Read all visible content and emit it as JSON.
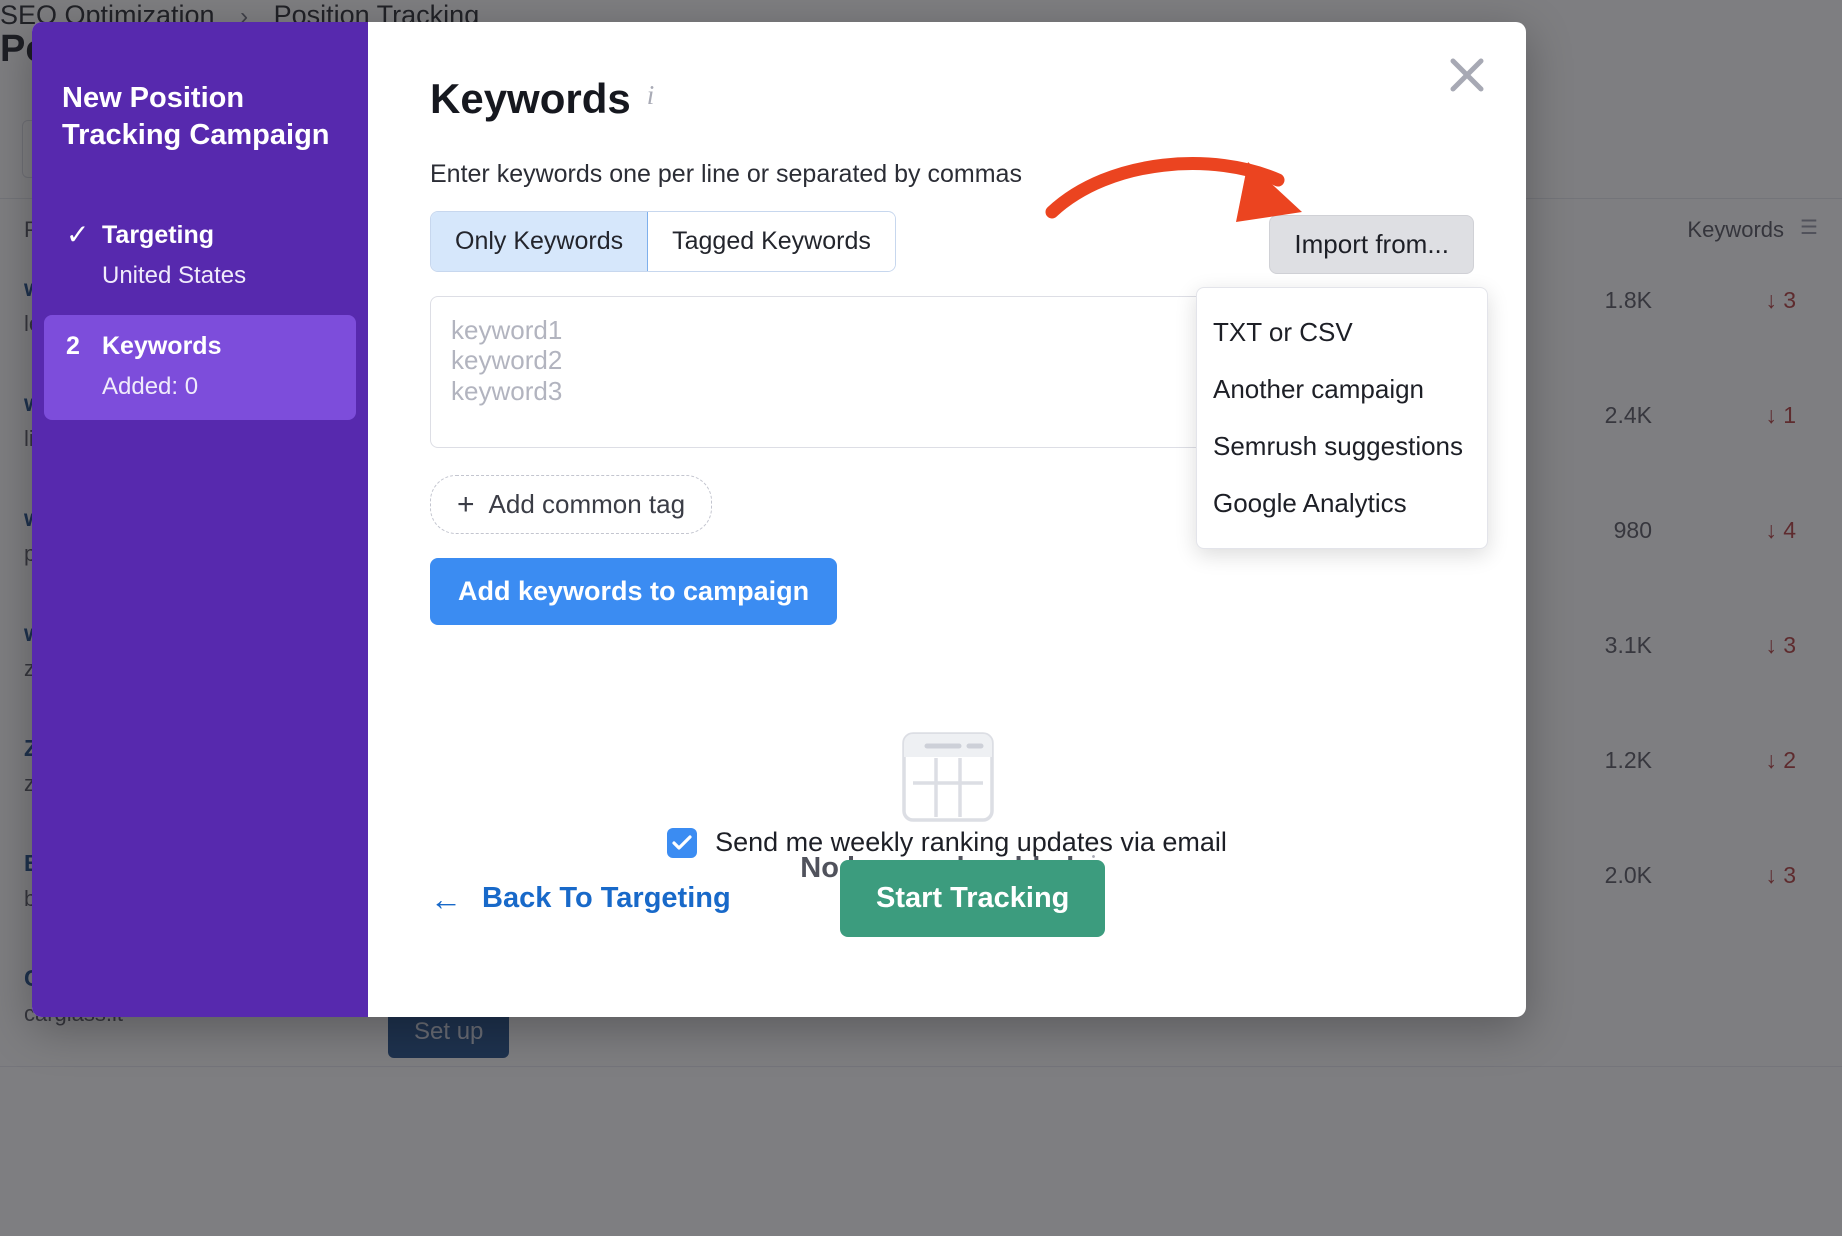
{
  "background": {
    "breadcrumb": {
      "parent": "SEO Optimization",
      "separator": "›",
      "current": "Position Tracking"
    },
    "page_title": "Position Tracking",
    "table": {
      "header_left": "Project",
      "header_right": "Keywords",
      "rows": [
        {
          "name": "www.autoglass.com",
          "url": "leoscheider.com",
          "metric": "1.8K",
          "delta": "↓ 3"
        },
        {
          "name": "www.vetro.com",
          "url": "lieferdienst.de",
          "metric": "2.4K",
          "delta": "↓ 1"
        },
        {
          "name": "www.scheiben.de",
          "url": "pitstop-auto.de",
          "metric": "980",
          "delta": "↓ 4"
        },
        {
          "name": "www.glasprofi.de",
          "url": "zentrum-glas.de",
          "metric": "3.1K",
          "delta": "↓ 3"
        },
        {
          "name": "Zentrum Auto",
          "url": "zautoglas.de",
          "metric": "1.2K",
          "delta": "↓ 2"
        },
        {
          "name": "Bosch Service",
          "url": "bosch-service.de",
          "metric": "2.0K",
          "delta": "↓ 3"
        },
        {
          "name": "Carglass",
          "url": "carglass.it",
          "metric": "",
          "delta": ""
        }
      ],
      "setup_button": "Set up"
    }
  },
  "modal": {
    "close_label": "Close",
    "sidebar": {
      "title": "New Position Tracking Campaign",
      "steps": [
        {
          "marker": "✓",
          "name": "Targeting",
          "sub": "United States",
          "active": false
        },
        {
          "marker": "2",
          "name": "Keywords",
          "sub": "Added: 0",
          "active": true
        }
      ]
    },
    "main": {
      "title": "Keywords",
      "title_info_glyph": "i",
      "helper_text": "Enter keywords one per line or separated by commas",
      "tabs": [
        {
          "label": "Only Keywords",
          "selected": true
        },
        {
          "label": "Tagged Keywords",
          "selected": false
        }
      ],
      "import_button_label": "Import from...",
      "import_menu": [
        "TXT or CSV",
        "Another campaign",
        "Semrush suggestions",
        "Google Analytics"
      ],
      "textarea_placeholder": "keyword1\nkeyword2\nkeyword3",
      "textarea_value": "",
      "add_common_tag_label": "Add common tag",
      "add_common_tag_plus": "+",
      "add_keywords_label": "Add keywords to campaign",
      "empty_state_label": "No keywords added",
      "empty_state_info_glyph": "i",
      "email_opt_label": "Send me weekly ranking updates via email",
      "email_opt_checked": true,
      "back_link_label": "Back To Targeting",
      "back_arrow": "←",
      "start_tracking_label": "Start Tracking"
    }
  },
  "colors": {
    "sidebar_purple": "#5729ae",
    "sidebar_active": "#7d4ddb",
    "primary_blue": "#3b8cf2",
    "success_green": "#3c9c7e",
    "annotation_red": "#eb4420",
    "link_blue": "#1869c9"
  }
}
